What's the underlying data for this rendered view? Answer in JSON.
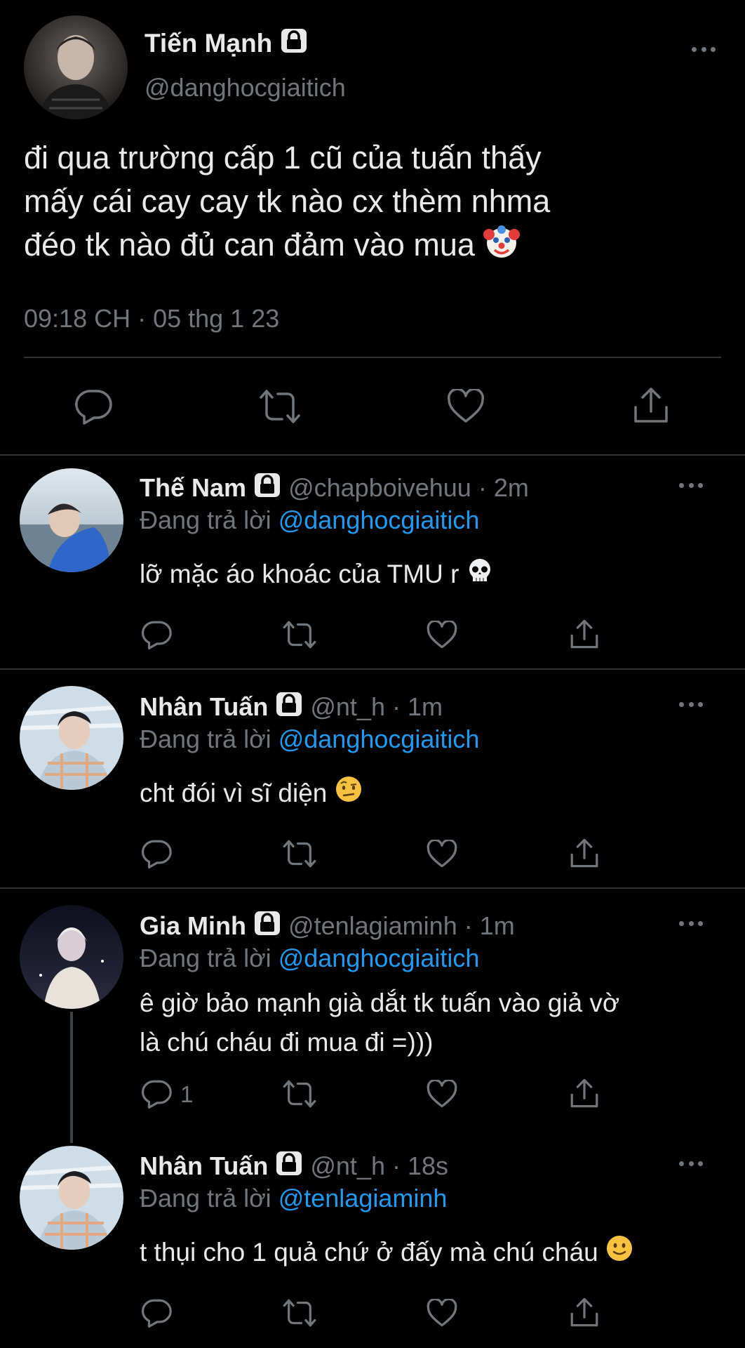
{
  "main_tweet": {
    "name": "Tiến Mạnh",
    "handle": "@danghocgiaitich",
    "text_lines": [
      "đi qua trường cấp 1 cũ của tuấn thấy",
      "mấy cái cay cay tk nào cx thèm nhma",
      "đéo tk nào đủ can đảm vào mua"
    ],
    "timestamp": "09:18 CH · 05 thg 1 23"
  },
  "replies": [
    {
      "name": "Thế Nam",
      "handle": "@chapboivehuu",
      "time": "· 2m",
      "reply_prefix": "Đang trả lời",
      "reply_to": "@danghocgiaitich",
      "text_lines": [
        "lỡ mặc áo khoác của TMU r"
      ],
      "reply_count": ""
    },
    {
      "name": "Nhân Tuấn",
      "handle": "@nt_h",
      "time": "· 1m",
      "reply_prefix": "Đang trả lời",
      "reply_to": "@danghocgiaitich",
      "text_lines": [
        "cht đói vì sĩ diện"
      ],
      "reply_count": ""
    },
    {
      "name": "Gia Minh",
      "handle": "@tenlagiaminh",
      "time": "· 1m",
      "reply_prefix": "Đang trả lời",
      "reply_to": "@danghocgiaitich",
      "text_lines": [
        "ê giờ bảo mạnh già dắt tk tuấn vào giả vờ",
        "là chú cháu đi mua đi =)))"
      ],
      "reply_count": "1"
    },
    {
      "name": "Nhân Tuấn",
      "handle": "@nt_h",
      "time": "· 18s",
      "reply_prefix": "Đang trả lời",
      "reply_to": "@tenlagiaminh",
      "text_lines": [
        "t thụi cho 1 quả chứ ở đấy mà chú cháu"
      ],
      "reply_count": ""
    }
  ],
  "icons": {
    "reply": "speech-bubble-icon",
    "retweet": "retweet-icon",
    "like": "heart-icon",
    "share": "share-icon",
    "lock": "lock-icon",
    "more": "more-dots-icon"
  },
  "colors": {
    "background": "#000000",
    "text": "#e7e9ea",
    "muted": "#71767b",
    "link": "#1d9bf0",
    "divider": "#2f3336"
  }
}
